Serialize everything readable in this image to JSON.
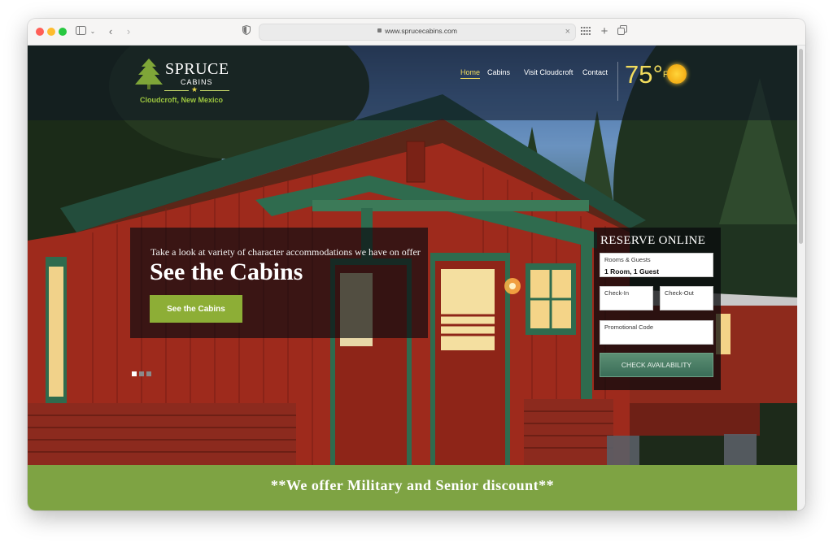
{
  "browser": {
    "url": "www.sprucecabins.com"
  },
  "site": {
    "logo": {
      "name": "SPRUCE",
      "sub": "CABINS",
      "location": "Cloudcroft, New Mexico"
    },
    "nav": [
      {
        "label": "Home",
        "active": true
      },
      {
        "label": "Cabins",
        "active": false
      },
      {
        "label": "Visit Cloudcroft",
        "active": false
      },
      {
        "label": "Contact",
        "active": false
      }
    ],
    "weather": {
      "temperature": "75°",
      "unit": "F",
      "icon": "sun-icon"
    }
  },
  "slider": {
    "kicker": "Take a look at variety of character accommodations we have on offer",
    "title": "See the Cabins",
    "cta": "See the Cabins",
    "dots": 3,
    "active_dot": 0
  },
  "reserve": {
    "title": "RESERVE ONLINE",
    "rooms_label": "Rooms & Guests",
    "rooms_value": "1 Room, 1 Guest",
    "checkin_label": "Check-In",
    "checkout_label": "Check-Out",
    "promo_label": "Promotional Code",
    "button": "CHECK AVAILABILITY"
  },
  "banner": {
    "text": "**We offer Military and Senior discount**"
  },
  "colors": {
    "accent_yellow": "#f2dc5d",
    "green": "#7ea343",
    "cta_green": "#8dae36",
    "cabin_red": "#9e2a1c",
    "trim_green": "#2f6b4e"
  }
}
